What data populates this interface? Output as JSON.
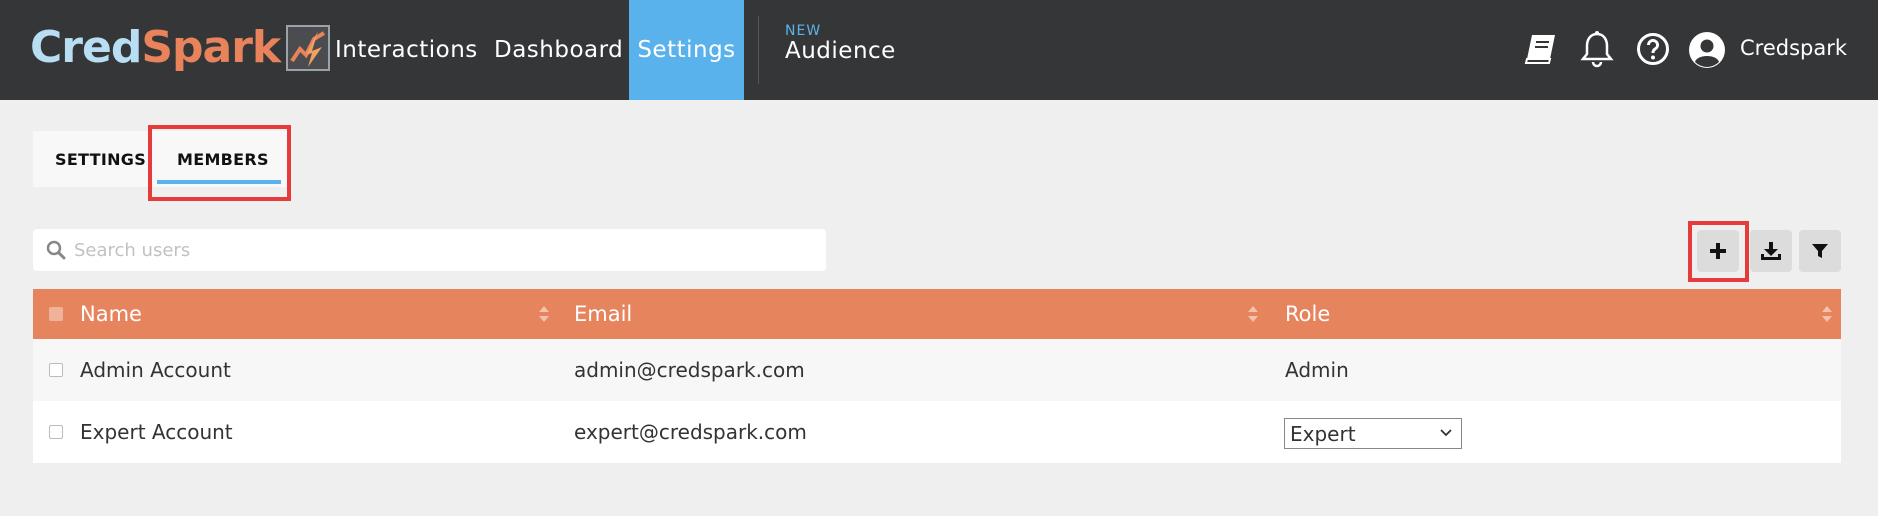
{
  "brand": {
    "part1": "Cred",
    "part2": "Spark"
  },
  "nav": {
    "items": [
      {
        "label": "Interactions"
      },
      {
        "label": "Dashboard"
      },
      {
        "label": "Settings"
      }
    ],
    "audience": {
      "badge": "NEW",
      "label": "Audience"
    }
  },
  "user": {
    "name": "Credspark"
  },
  "icons": {
    "guide": "book-icon",
    "notifications": "bell-icon",
    "help": "question-circle-icon",
    "user": "user-avatar-icon",
    "search": "search-icon",
    "add": "plus-icon",
    "download": "download-icon",
    "filter": "filter-icon"
  },
  "colors": {
    "topbar": "#353638",
    "accent": "#5ab2ec",
    "table_header": "#e6845e",
    "highlight": "#e53b3b"
  },
  "tabs": [
    {
      "label": "SETTINGS",
      "active": false
    },
    {
      "label": "MEMBERS",
      "active": true
    }
  ],
  "search": {
    "placeholder": "Search users",
    "value": ""
  },
  "table": {
    "columns": [
      {
        "label": "Name"
      },
      {
        "label": "Email"
      },
      {
        "label": "Role"
      }
    ],
    "rows": [
      {
        "name": "Admin Account",
        "email": "admin@credspark.com",
        "role": "Admin"
      },
      {
        "name": "Expert Account",
        "email": "expert@credspark.com",
        "role": "Expert"
      }
    ]
  }
}
